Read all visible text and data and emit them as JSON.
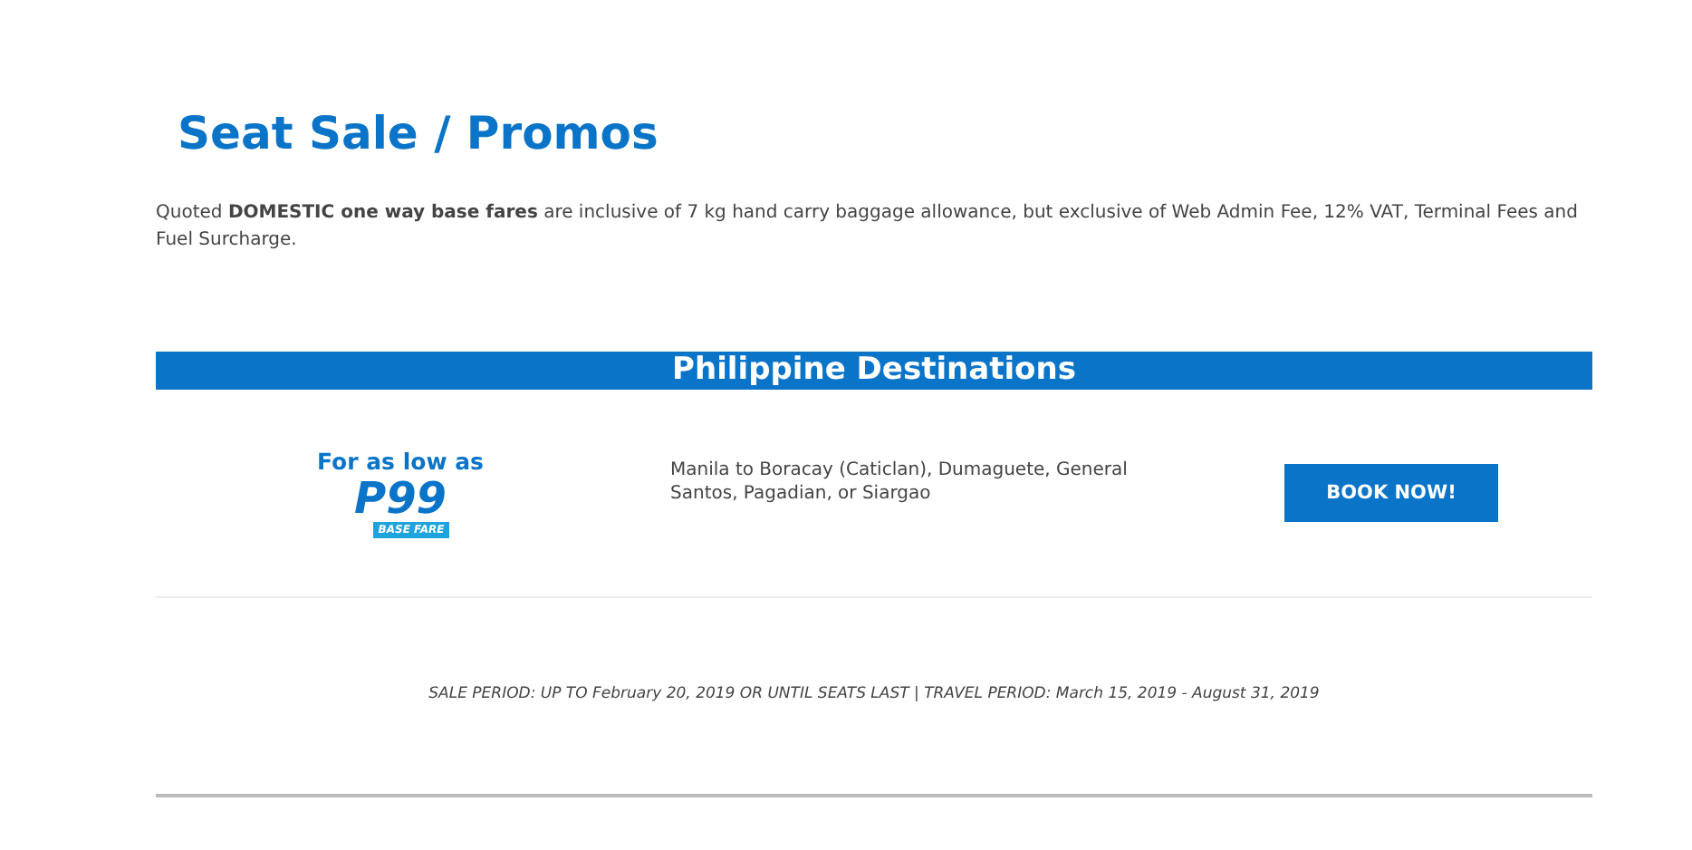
{
  "title": "Seat Sale / Promos",
  "intro": "Quoted **DOMESTIC one way base fares** are inclusive of 7 kg hand carry baggage allowance, but exclusive of Web Admin Fee, 12% VAT, Terminal Fees and Fuel Surcharge.",
  "section": {
    "heading": "Philippine Destinations",
    "promo": {
      "lead": "For as low as",
      "price": "P99",
      "price_tag": "BASE FARE",
      "routes": "Manila to Boracay (Caticlan), Dumaguete, General Santos, Pagadian, or Siargao",
      "button": "BOOK NOW!"
    }
  },
  "period": "SALE PERIOD: UP TO February 20, 2019 OR UNTIL SEATS LAST | TRAVEL PERIOD: March 15, 2019 - August 31, 2019"
}
